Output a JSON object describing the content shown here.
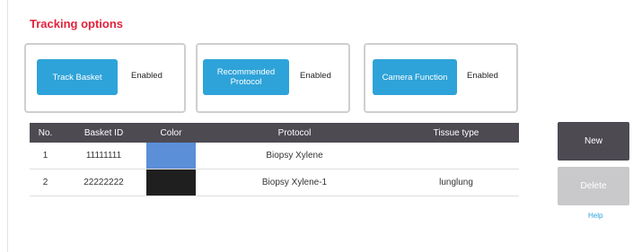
{
  "section": {
    "title": "Tracking options"
  },
  "options": [
    {
      "label": "Track Basket",
      "status": "Enabled"
    },
    {
      "label": "Recommended Protocol",
      "status": "Enabled"
    },
    {
      "label": "Camera Function",
      "status": "Enabled"
    }
  ],
  "table": {
    "headers": [
      "No.",
      "Basket ID",
      "Color",
      "Protocol",
      "Tissue type"
    ],
    "rows": [
      {
        "no": "1",
        "basket_id": "11111111",
        "color": "#5b8fd8",
        "protocol": "Biopsy Xylene",
        "tissue_type": ""
      },
      {
        "no": "2",
        "basket_id": "22222222",
        "color": "#1f1f1f",
        "protocol": "Biopsy Xylene-1",
        "tissue_type": "lunglung"
      }
    ]
  },
  "actions": {
    "new_label": "New",
    "delete_label": "Delete",
    "help_label": "Help"
  },
  "colors": {
    "accent": "#2ea3d9",
    "title": "#e2223b",
    "header_bg": "#4d4a52",
    "disabled": "#c9c9cb"
  }
}
